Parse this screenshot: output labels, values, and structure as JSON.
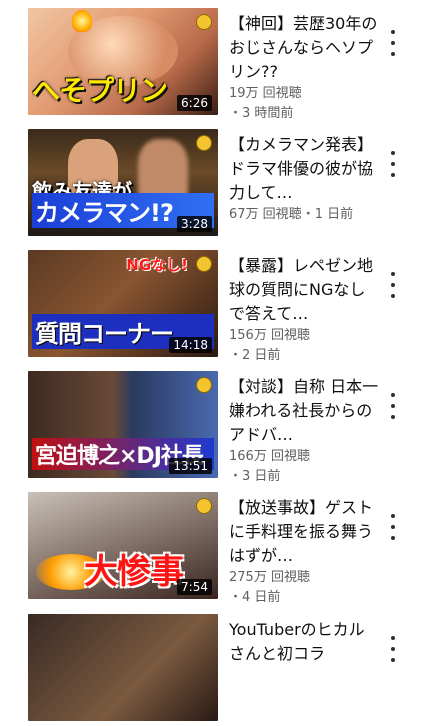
{
  "videos": [
    {
      "title": "【神回】芸歴30年のおじさんならヘソプリン??",
      "views": "19万 回視聴",
      "age": "・3 時間前",
      "duration": "6:26",
      "thumb_caption": "へそプリン"
    },
    {
      "title": "【カメラマン発表】ドラマ俳優の彼が協力して…",
      "views": "67万 回視聴",
      "age": "・1 日前",
      "duration": "3:28",
      "thumb_caption_top": "飲み友達が",
      "thumb_caption": "カメラマン!?"
    },
    {
      "title": "【暴露】レペゼン地球の質問にNGなしで答えて…",
      "views": "156万 回視聴",
      "age": "・2 日前",
      "duration": "14:18",
      "thumb_tag": "NGなし!",
      "thumb_caption": "質問コーナー"
    },
    {
      "title": "【対談】自称 日本一嫌われる社長からのアドバ…",
      "views": "166万 回視聴",
      "age": "・3 日前",
      "duration": "13:51",
      "thumb_caption": "宮迫博之×DJ社長"
    },
    {
      "title": "【放送事故】ゲストに手料理を振る舞うはずが…",
      "views": "275万 回視聴",
      "age": "・4 日前",
      "duration": "7:54",
      "thumb_caption": "大惨事"
    },
    {
      "title": "YouTuberのヒカルさんと初コラ",
      "views": "",
      "age": "",
      "duration": ""
    }
  ]
}
